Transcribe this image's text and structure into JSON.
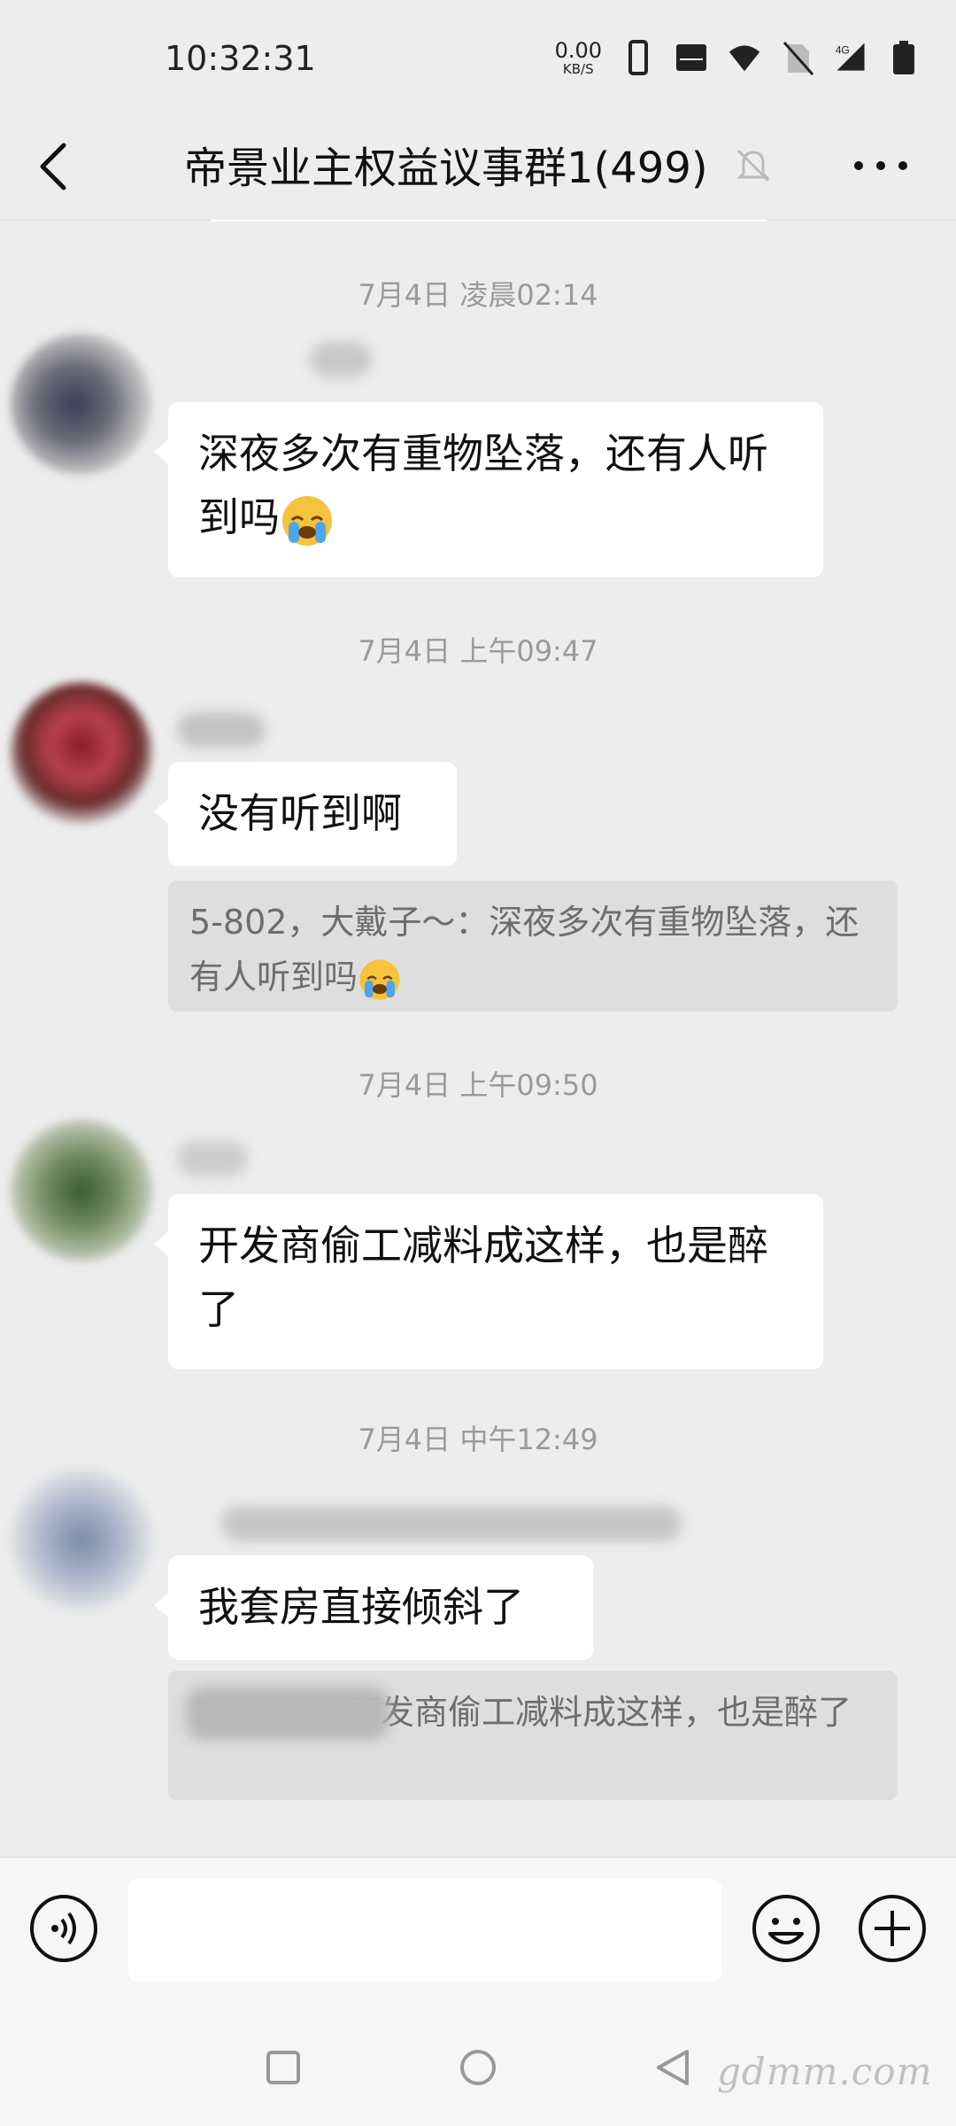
{
  "status_bar": {
    "time": "10:32:31",
    "net_speed_value": "0.00",
    "net_speed_unit": "KB/S",
    "network_label": "4G",
    "icons": [
      "phone-icon",
      "volte-icon",
      "wifi-icon",
      "no-sim-icon",
      "signal-icon",
      "battery-icon"
    ]
  },
  "header": {
    "title": "帝景业主权益议事群1(499)",
    "icons": [
      "back-icon",
      "mute-bell-icon",
      "more-icon"
    ]
  },
  "messages": [
    {
      "timestamp": "7月4日 凌晨02:14",
      "text": "深夜多次有重物坠落，还有人听到吗",
      "emoji": "loudly-crying-face"
    },
    {
      "timestamp": "7月4日 上午09:47",
      "text": "没有听到啊",
      "quote": "5-802，大戴子～：深夜多次有重物坠落，还有人听到吗",
      "quote_emoji": "loudly-crying-face"
    },
    {
      "timestamp": "7月4日 上午09:50",
      "text": "开发商偷工减料成这样，也是醉了"
    },
    {
      "timestamp": "7月4日 中午12:49",
      "text": "我套房直接倾斜了",
      "quote": "开发商偷工减料成这样，也是醉了"
    }
  ],
  "input_bar": {
    "text_value": "",
    "icons": [
      "voice-icon",
      "emoji-icon",
      "plus-icon"
    ]
  },
  "nav_bar": {
    "icons": [
      "recent-apps-icon",
      "home-icon",
      "back-triangle-icon"
    ],
    "watermark": "gdmm.com"
  },
  "colors": {
    "background": "#ededed",
    "bubble": "#ffffff",
    "quote_bg": "#dedede",
    "timestamp": "#9a9a9a"
  }
}
